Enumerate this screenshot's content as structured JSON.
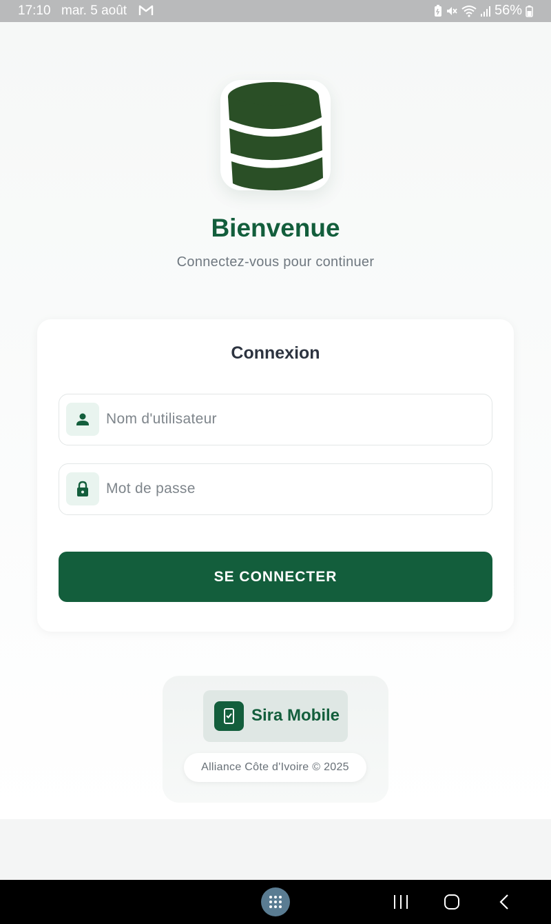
{
  "status_bar": {
    "time": "17:10",
    "date": "mar. 5 août",
    "battery_percent": "56%",
    "icons": [
      "gmail-icon",
      "battery-saver-icon",
      "mute-icon",
      "wifi-icon",
      "signal-icon",
      "battery-icon"
    ]
  },
  "app": {
    "logo_icon": "database-icon",
    "title": "Bienvenue",
    "subtitle": "Connectez-vous pour continuer"
  },
  "login": {
    "heading": "Connexion",
    "username": {
      "placeholder": "Nom d'utilisateur",
      "value": "",
      "icon": "person-icon"
    },
    "password": {
      "placeholder": "Mot de passe",
      "value": "",
      "icon": "lock-icon"
    },
    "submit_label": "SE CONNECTER"
  },
  "footer": {
    "brand_name": "Sira Mobile",
    "brand_icon": "mobile-check-icon",
    "copyright": "Alliance Côte d'Ivoire © 2025"
  },
  "nav_bar": {
    "buttons": [
      "app-drawer-icon",
      "recent-apps-icon",
      "home-icon",
      "back-icon"
    ]
  },
  "colors": {
    "primary": "#135e3c",
    "logo_dark": "#2a4f26",
    "status_bar": "#b9babb",
    "subtitle": "#6f7880"
  }
}
